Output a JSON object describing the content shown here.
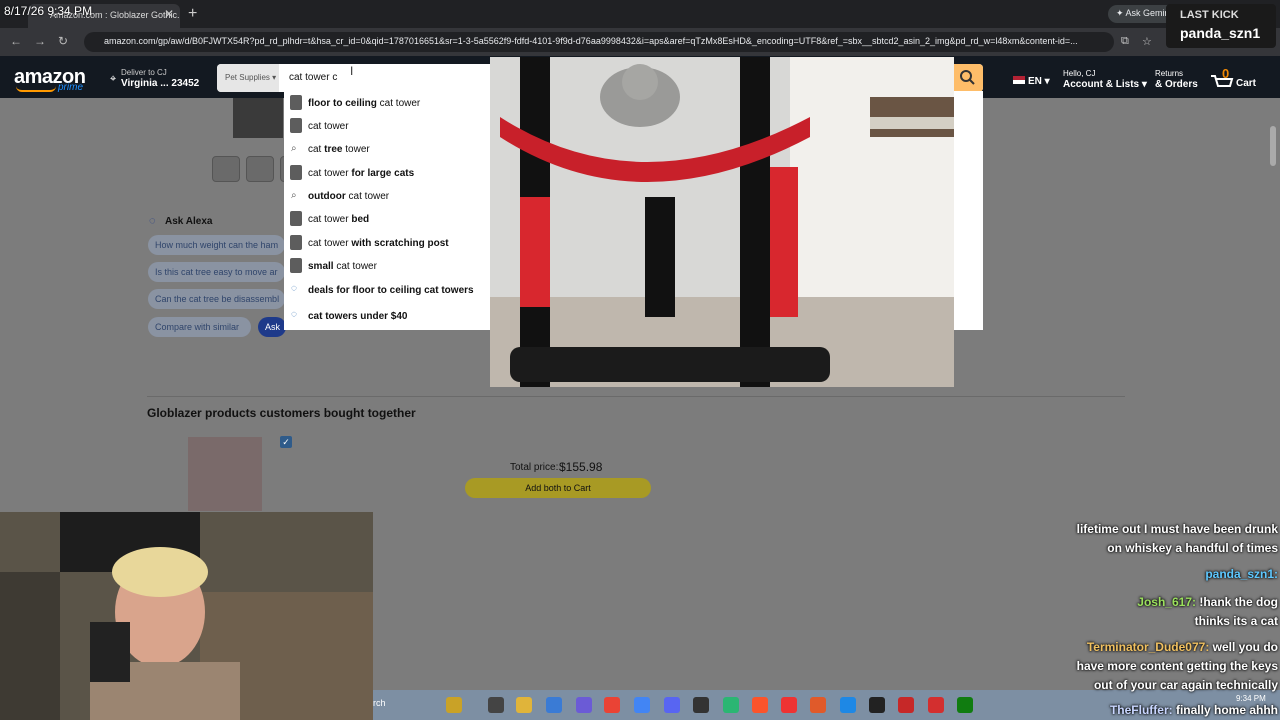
{
  "browser": {
    "tab_title": "Amazon.com : Globlazer Gothic...",
    "url": "amazon.com/gp/aw/d/B0FJWTX54R?pd_rd_plhdr=t&hsa_cr_id=0&qid=1787016651&sr=1-3-5a5562f9-fdfd-4101-9f9d-d76aa9998432&i=aps&aref=qTzMx8EsHD&_encoding=UTF8&ref_=sbx__sbtcd2_asin_2_img&pd_rd_w=l48xm&content-id=...",
    "gemini_label": "Ask Gemini"
  },
  "header": {
    "logo": "amazon",
    "logo_sub": "prime",
    "deliver_small": "Deliver to CJ",
    "deliver_big": "Virginia ... 23452",
    "department": "Pet Supplies",
    "search_value": "cat tower c",
    "language": "EN",
    "account_small": "Hello, CJ",
    "account_big": "Account & Lists",
    "returns_small": "Returns",
    "returns_big": "& Orders",
    "cart_count": "0",
    "cart_label": "Cart"
  },
  "suggestions": [
    {
      "pre": "",
      "bold": "floor to ceiling",
      "post": " cat tower",
      "icon": "thumb"
    },
    {
      "pre": "cat tower",
      "bold": "",
      "post": "",
      "icon": "thumb"
    },
    {
      "pre": "cat ",
      "bold": "tree",
      "post": " tower",
      "icon": "search"
    },
    {
      "pre": "cat tower ",
      "bold": "for large cats",
      "post": "",
      "icon": "thumb"
    },
    {
      "pre": "",
      "bold": "outdoor",
      "post": " cat tower",
      "icon": "search"
    },
    {
      "pre": "cat tower ",
      "bold": "bed",
      "post": "",
      "icon": "thumb"
    },
    {
      "pre": "cat tower ",
      "bold": "with scratching post",
      "post": "",
      "icon": "thumb"
    },
    {
      "pre": "",
      "bold": "small",
      "post": " cat tower",
      "icon": "thumb"
    },
    {
      "pre": "",
      "bold": "deals for floor to ceiling cat towers",
      "post": "",
      "icon": "alexa"
    },
    {
      "pre": "",
      "bold": "cat towers under $40",
      "post": "",
      "icon": "alexa"
    }
  ],
  "alexa": {
    "title": "Ask Alexa",
    "chips": [
      "How much weight can the ham",
      "Is this cat tree easy to move ar",
      "Can the cat tree be disassembl",
      "Compare with similar",
      "Ask"
    ]
  },
  "together": {
    "title": "Globlazer products customers bought together",
    "total_label": "Total price:",
    "total_price": "$155.98",
    "add_button": "Add both to Cart"
  },
  "overlay": {
    "clock": "8/17/26 9:34 PM",
    "last_kick_title": "LAST KICK",
    "last_kick_name": "panda_szn1",
    "taskbar_search": "rch",
    "taskbar_time": "9:34 PM"
  },
  "chat": [
    {
      "user": "",
      "text": "lifetime out I must have been drunk"
    },
    {
      "user": "",
      "text": "on whiskey a handful of times"
    },
    {
      "user": "panda_szn1:",
      "text": ""
    },
    {
      "user": "Josh_617:",
      "text": " !hank the dog"
    },
    {
      "user": "",
      "text": "thinks its a cat"
    },
    {
      "user": "Terminator_Dude077:",
      "text": " well you do"
    },
    {
      "user": "",
      "text": "have more content getting the keys"
    },
    {
      "user": "",
      "text": "out of your car again technically"
    },
    {
      "user": "TheFluffer:",
      "text": " finally home ahhh"
    }
  ],
  "colors": {
    "amazon_nav": "#131921",
    "amazon_orange": "#ff9900",
    "search_button": "#febd69",
    "chat_green": "#9be15d"
  }
}
